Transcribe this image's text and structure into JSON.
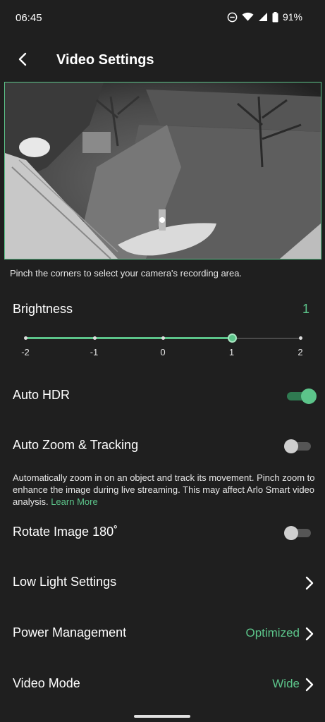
{
  "status_bar": {
    "time": "06:45",
    "battery_percent": "91%",
    "icons": [
      "do-not-disturb-icon",
      "wifi-icon",
      "cell-signal-icon",
      "battery-icon"
    ]
  },
  "header": {
    "title": "Video Settings",
    "back_icon": "back-arrow-icon"
  },
  "camera": {
    "hint": "Pinch the corners to select your camera's recording area."
  },
  "brightness": {
    "label": "Brightness",
    "value": "1",
    "min": -2,
    "max": 2,
    "current": 1,
    "ticks": [
      "-2",
      "-1",
      "0",
      "1",
      "2"
    ]
  },
  "settings": {
    "auto_hdr": {
      "label": "Auto HDR",
      "enabled": true
    },
    "auto_zoom": {
      "label": "Auto Zoom & Tracking",
      "enabled": false,
      "description": "Automatically zoom in on an object and track its movement. Pinch zoom to enhance the image during live streaming. This may affect Arlo Smart video analysis.",
      "learn_more": "Learn More"
    },
    "rotate": {
      "label": "Rotate Image 180˚",
      "enabled": false
    },
    "low_light": {
      "label": "Low Light Settings"
    },
    "power": {
      "label": "Power Management",
      "value": "Optimized"
    },
    "video_mode": {
      "label": "Video Mode",
      "value": "Wide"
    }
  },
  "colors": {
    "accent": "#5cc48a",
    "background": "#1f1f1f",
    "text": "#ffffff"
  }
}
